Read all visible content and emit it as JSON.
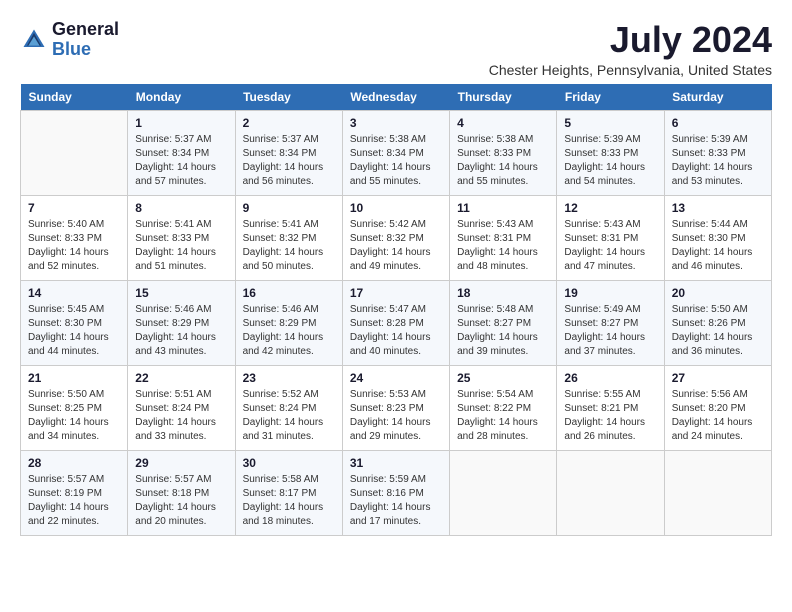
{
  "header": {
    "logo_line1": "General",
    "logo_line2": "Blue",
    "month": "July 2024",
    "location": "Chester Heights, Pennsylvania, United States"
  },
  "days_of_week": [
    "Sunday",
    "Monday",
    "Tuesday",
    "Wednesday",
    "Thursday",
    "Friday",
    "Saturday"
  ],
  "weeks": [
    [
      {
        "day": "",
        "info": ""
      },
      {
        "day": "1",
        "info": "Sunrise: 5:37 AM\nSunset: 8:34 PM\nDaylight: 14 hours\nand 57 minutes."
      },
      {
        "day": "2",
        "info": "Sunrise: 5:37 AM\nSunset: 8:34 PM\nDaylight: 14 hours\nand 56 minutes."
      },
      {
        "day": "3",
        "info": "Sunrise: 5:38 AM\nSunset: 8:34 PM\nDaylight: 14 hours\nand 55 minutes."
      },
      {
        "day": "4",
        "info": "Sunrise: 5:38 AM\nSunset: 8:33 PM\nDaylight: 14 hours\nand 55 minutes."
      },
      {
        "day": "5",
        "info": "Sunrise: 5:39 AM\nSunset: 8:33 PM\nDaylight: 14 hours\nand 54 minutes."
      },
      {
        "day": "6",
        "info": "Sunrise: 5:39 AM\nSunset: 8:33 PM\nDaylight: 14 hours\nand 53 minutes."
      }
    ],
    [
      {
        "day": "7",
        "info": "Sunrise: 5:40 AM\nSunset: 8:33 PM\nDaylight: 14 hours\nand 52 minutes."
      },
      {
        "day": "8",
        "info": "Sunrise: 5:41 AM\nSunset: 8:33 PM\nDaylight: 14 hours\nand 51 minutes."
      },
      {
        "day": "9",
        "info": "Sunrise: 5:41 AM\nSunset: 8:32 PM\nDaylight: 14 hours\nand 50 minutes."
      },
      {
        "day": "10",
        "info": "Sunrise: 5:42 AM\nSunset: 8:32 PM\nDaylight: 14 hours\nand 49 minutes."
      },
      {
        "day": "11",
        "info": "Sunrise: 5:43 AM\nSunset: 8:31 PM\nDaylight: 14 hours\nand 48 minutes."
      },
      {
        "day": "12",
        "info": "Sunrise: 5:43 AM\nSunset: 8:31 PM\nDaylight: 14 hours\nand 47 minutes."
      },
      {
        "day": "13",
        "info": "Sunrise: 5:44 AM\nSunset: 8:30 PM\nDaylight: 14 hours\nand 46 minutes."
      }
    ],
    [
      {
        "day": "14",
        "info": "Sunrise: 5:45 AM\nSunset: 8:30 PM\nDaylight: 14 hours\nand 44 minutes."
      },
      {
        "day": "15",
        "info": "Sunrise: 5:46 AM\nSunset: 8:29 PM\nDaylight: 14 hours\nand 43 minutes."
      },
      {
        "day": "16",
        "info": "Sunrise: 5:46 AM\nSunset: 8:29 PM\nDaylight: 14 hours\nand 42 minutes."
      },
      {
        "day": "17",
        "info": "Sunrise: 5:47 AM\nSunset: 8:28 PM\nDaylight: 14 hours\nand 40 minutes."
      },
      {
        "day": "18",
        "info": "Sunrise: 5:48 AM\nSunset: 8:27 PM\nDaylight: 14 hours\nand 39 minutes."
      },
      {
        "day": "19",
        "info": "Sunrise: 5:49 AM\nSunset: 8:27 PM\nDaylight: 14 hours\nand 37 minutes."
      },
      {
        "day": "20",
        "info": "Sunrise: 5:50 AM\nSunset: 8:26 PM\nDaylight: 14 hours\nand 36 minutes."
      }
    ],
    [
      {
        "day": "21",
        "info": "Sunrise: 5:50 AM\nSunset: 8:25 PM\nDaylight: 14 hours\nand 34 minutes."
      },
      {
        "day": "22",
        "info": "Sunrise: 5:51 AM\nSunset: 8:24 PM\nDaylight: 14 hours\nand 33 minutes."
      },
      {
        "day": "23",
        "info": "Sunrise: 5:52 AM\nSunset: 8:24 PM\nDaylight: 14 hours\nand 31 minutes."
      },
      {
        "day": "24",
        "info": "Sunrise: 5:53 AM\nSunset: 8:23 PM\nDaylight: 14 hours\nand 29 minutes."
      },
      {
        "day": "25",
        "info": "Sunrise: 5:54 AM\nSunset: 8:22 PM\nDaylight: 14 hours\nand 28 minutes."
      },
      {
        "day": "26",
        "info": "Sunrise: 5:55 AM\nSunset: 8:21 PM\nDaylight: 14 hours\nand 26 minutes."
      },
      {
        "day": "27",
        "info": "Sunrise: 5:56 AM\nSunset: 8:20 PM\nDaylight: 14 hours\nand 24 minutes."
      }
    ],
    [
      {
        "day": "28",
        "info": "Sunrise: 5:57 AM\nSunset: 8:19 PM\nDaylight: 14 hours\nand 22 minutes."
      },
      {
        "day": "29",
        "info": "Sunrise: 5:57 AM\nSunset: 8:18 PM\nDaylight: 14 hours\nand 20 minutes."
      },
      {
        "day": "30",
        "info": "Sunrise: 5:58 AM\nSunset: 8:17 PM\nDaylight: 14 hours\nand 18 minutes."
      },
      {
        "day": "31",
        "info": "Sunrise: 5:59 AM\nSunset: 8:16 PM\nDaylight: 14 hours\nand 17 minutes."
      },
      {
        "day": "",
        "info": ""
      },
      {
        "day": "",
        "info": ""
      },
      {
        "day": "",
        "info": ""
      }
    ]
  ]
}
